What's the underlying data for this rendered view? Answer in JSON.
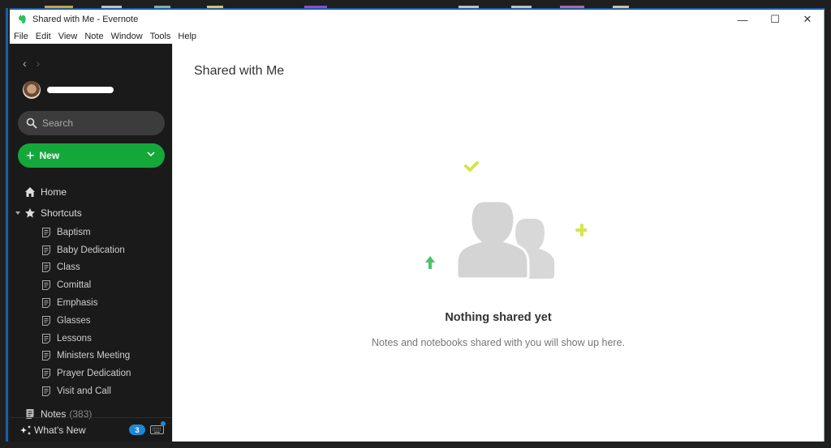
{
  "window": {
    "title": "Shared with Me - Evernote",
    "controls": {
      "minimize": "—",
      "maximize": "☐",
      "close": "✕"
    }
  },
  "menubar": {
    "items": [
      "File",
      "Edit",
      "View",
      "Note",
      "Window",
      "Tools",
      "Help"
    ]
  },
  "sidebar": {
    "back_arrow": "‹",
    "forward_arrow": "›",
    "search": {
      "placeholder": "Search",
      "value": ""
    },
    "new_button": {
      "plus": "+",
      "label": "New"
    },
    "home_label": "Home",
    "shortcuts_label": "Shortcuts",
    "shortcuts": [
      "Baptism",
      "Baby Dedication",
      "Class",
      "Comittal",
      "Emphasis",
      "Glasses",
      "Lessons",
      "Ministers Meeting",
      "Prayer Dedication",
      "Visit and Call"
    ],
    "notes_label": "Notes",
    "notes_count": "(383)",
    "footer": {
      "whats_new_label": "What's New",
      "badge_count": "3"
    }
  },
  "main": {
    "page_title": "Shared with Me",
    "empty_state": {
      "title": "Nothing shared yet",
      "description": "Notes and notebooks shared with you will show up here."
    }
  },
  "colors": {
    "accent_green": "#14a83b",
    "sidebar_bg": "#1a1a1a",
    "badge_blue": "#1e88d8",
    "check_yellow": "#d7e34a",
    "arrow_green": "#4cc46a"
  }
}
